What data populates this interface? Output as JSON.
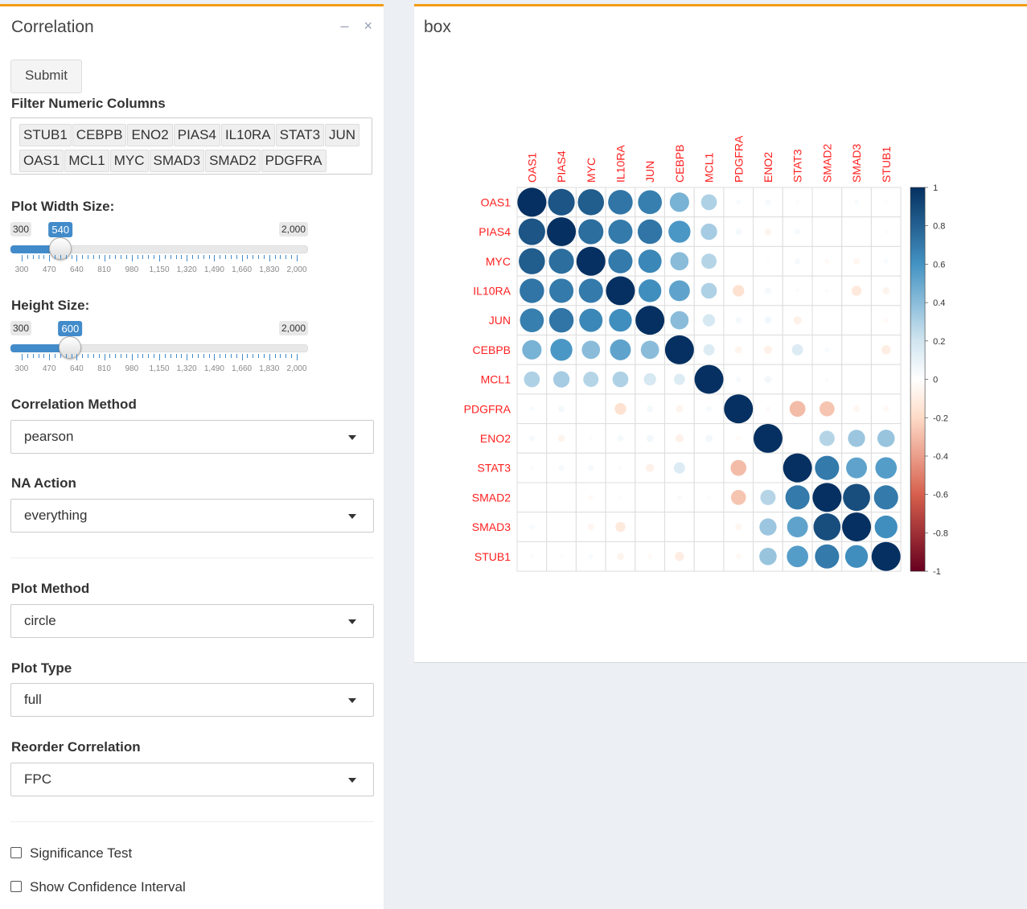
{
  "left_panel": {
    "title": "Correlation",
    "minimize_icon": "minus-icon",
    "close_icon": "times-icon",
    "submit_label": "Submit",
    "filter_label": "Filter Numeric Columns",
    "filter_tags": [
      "STUB1",
      "CEBPB",
      "ENO2",
      "PIAS4",
      "IL10RA",
      "STAT3",
      "JUN",
      "OAS1",
      "MCL1",
      "MYC",
      "SMAD3",
      "SMAD2",
      "PDGFRA"
    ],
    "width_slider": {
      "label": "Plot Width Size:",
      "min_label": "300",
      "max_label": "2,000",
      "value_label": "540",
      "min": 300,
      "max": 2000,
      "value": 540,
      "grid": [
        "300",
        "470",
        "640",
        "810",
        "980",
        "1,150",
        "1,320",
        "1,490",
        "1,660",
        "1,830",
        "2,000"
      ]
    },
    "height_slider": {
      "label": "Height Size:",
      "min_label": "300",
      "max_label": "2,000",
      "value_label": "600",
      "min": 300,
      "max": 2000,
      "value": 600,
      "grid": [
        "300",
        "470",
        "640",
        "810",
        "980",
        "1,150",
        "1,320",
        "1,490",
        "1,660",
        "1,830",
        "2,000"
      ]
    },
    "correlation_method": {
      "label": "Correlation Method",
      "value": "pearson"
    },
    "na_action": {
      "label": "NA Action",
      "value": "everything"
    },
    "plot_method": {
      "label": "Plot Method",
      "value": "circle"
    },
    "plot_type": {
      "label": "Plot Type",
      "value": "full"
    },
    "reorder": {
      "label": "Reorder Correlation",
      "value": "FPC"
    },
    "significance_test": {
      "label": "Significance Test",
      "checked": false
    },
    "confidence_interval": {
      "label": "Show Confidence Interval",
      "checked": false
    }
  },
  "right_panel": {
    "title": "box"
  },
  "colors": {
    "accent": "#f39c12",
    "slider": "#428bca",
    "label_red": "#ff2020"
  },
  "chart_data": {
    "type": "heatmap",
    "variables": [
      "OAS1",
      "PIAS4",
      "MYC",
      "IL10RA",
      "JUN",
      "CEBPB",
      "MCL1",
      "PDGFRA",
      "ENO2",
      "STAT3",
      "SMAD2",
      "SMAD3",
      "STUB1"
    ],
    "matrix": [
      [
        1.0,
        0.85,
        0.82,
        0.72,
        0.68,
        0.45,
        0.3,
        0.03,
        0.04,
        0.02,
        0.01,
        0.03,
        0.02
      ],
      [
        0.85,
        1.0,
        0.75,
        0.7,
        0.72,
        0.58,
        0.32,
        0.05,
        -0.06,
        0.04,
        0.01,
        0.01,
        0.02
      ],
      [
        0.82,
        0.75,
        1.0,
        0.7,
        0.65,
        0.4,
        0.28,
        0.0,
        0.02,
        0.04,
        -0.03,
        -0.05,
        0.03
      ],
      [
        0.72,
        0.7,
        0.7,
        1.0,
        0.62,
        0.52,
        0.3,
        -0.16,
        0.05,
        0.02,
        0.02,
        -0.12,
        -0.06
      ],
      [
        0.68,
        0.72,
        0.65,
        0.62,
        1.0,
        0.4,
        0.18,
        0.05,
        0.06,
        -0.08,
        0.01,
        0.01,
        -0.03
      ],
      [
        0.45,
        0.58,
        0.4,
        0.52,
        0.4,
        1.0,
        0.15,
        -0.06,
        -0.08,
        0.15,
        0.03,
        0.01,
        -0.1
      ],
      [
        0.3,
        0.32,
        0.28,
        0.3,
        0.18,
        0.15,
        1.0,
        0.04,
        0.06,
        0.01,
        0.02,
        0.0,
        0.01
      ],
      [
        0.03,
        0.05,
        0.0,
        -0.16,
        0.05,
        -0.06,
        0.04,
        1.0,
        -0.03,
        -0.3,
        -0.27,
        -0.05,
        -0.04
      ],
      [
        0.04,
        -0.06,
        0.02,
        0.05,
        0.06,
        -0.08,
        0.06,
        -0.03,
        1.0,
        0.0,
        0.28,
        0.35,
        0.36
      ],
      [
        0.02,
        0.04,
        0.04,
        0.02,
        -0.08,
        0.15,
        0.01,
        -0.3,
        0.0,
        1.0,
        0.7,
        0.52,
        0.55
      ],
      [
        0.01,
        0.01,
        -0.03,
        0.02,
        0.01,
        0.03,
        0.02,
        -0.27,
        0.28,
        0.7,
        1.0,
        0.88,
        0.7
      ],
      [
        0.03,
        0.01,
        -0.05,
        -0.12,
        0.01,
        0.01,
        0.0,
        -0.05,
        0.35,
        0.52,
        0.88,
        1.0,
        0.62
      ],
      [
        0.02,
        0.02,
        0.03,
        -0.06,
        -0.03,
        -0.1,
        0.01,
        -0.04,
        0.36,
        0.55,
        0.7,
        0.62,
        1.0
      ]
    ],
    "legend_ticks": [
      "1",
      "0.8",
      "0.6",
      "0.4",
      "0.2",
      "0",
      "-0.2",
      "-0.4",
      "-0.6",
      "-0.8",
      "-1"
    ],
    "color_range": [
      -1,
      1
    ]
  }
}
